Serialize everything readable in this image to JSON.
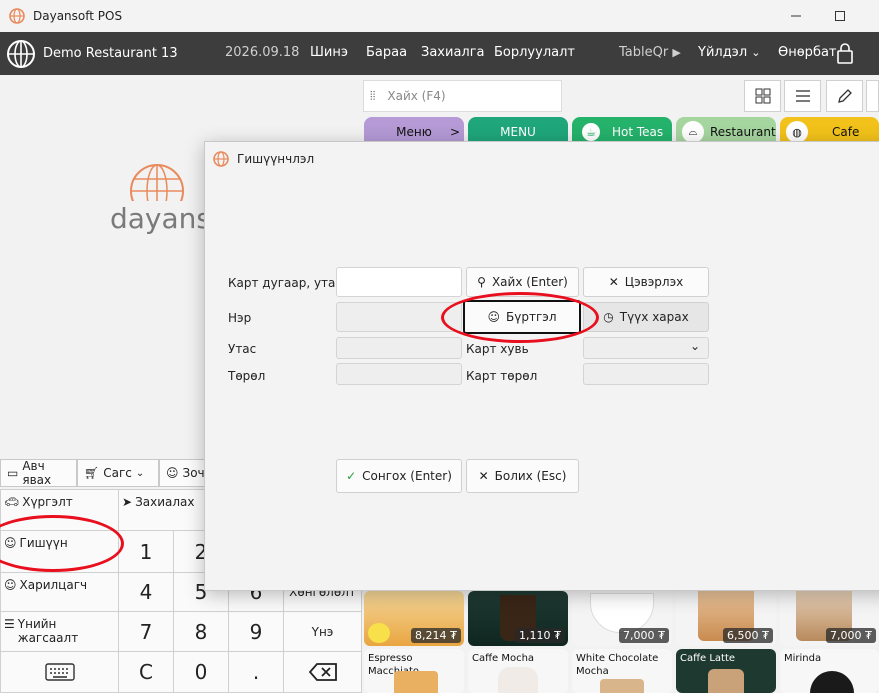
{
  "window": {
    "title": "Dayansoft POS"
  },
  "header": {
    "restaurant": "Demo Restaurant 13",
    "date": "2026.09.18",
    "menu": [
      "Шинэ",
      "Бараа",
      "Захиалга",
      "Борлуулалт"
    ],
    "tableqr": "TableQr",
    "actions": "Үйлдэл",
    "user": "Өнөрбат"
  },
  "left": {
    "logo_text": "dayans",
    "toolbar": [
      "Авч явах",
      "Сагс",
      "Зоч"
    ],
    "side": [
      "Хүргэлт",
      "Захиалах",
      "Гишүүн",
      "Харилцагч",
      "Үнийн жагсаалт"
    ],
    "keys": [
      "1",
      "2",
      "4",
      "5",
      "6",
      "7",
      "8",
      "9",
      "C",
      "0",
      "."
    ],
    "key_labels": {
      "honglolt": "Хөнгөлөлт",
      "une": "Үнэ"
    }
  },
  "right": {
    "search_placeholder": "Хайх (F4)",
    "categories": [
      "Меню",
      "MENU",
      "Hot Teas",
      "Restaurant",
      "Cafe"
    ],
    "products_row1": [
      {
        "price": "8,214 ₮"
      },
      {
        "price": "1,110 ₮"
      },
      {
        "price": "7,000 ₮"
      },
      {
        "price": "6,500 ₮"
      },
      {
        "price": "7,000 ₮"
      }
    ],
    "products_row2": [
      "Espresso Macchiato",
      "Caffe Mocha",
      "White Chocolate Mocha",
      "Caffe Latte",
      "Mirinda"
    ]
  },
  "dialog": {
    "title": "Гишүүнчлэл",
    "card_label": "Карт дугаар, утас",
    "search_btn": "Хайх (Enter)",
    "clear_btn": "Цэвэрлэх",
    "name_label": "Нэр",
    "register_btn": "Бүртгэл",
    "history_btn": "Түүх харах",
    "phone_label": "Утас",
    "card_share_label": "Карт хувь",
    "type_label": "Төрөл",
    "card_type_label": "Карт төрөл",
    "select_btn": "Сонгох (Enter)",
    "cancel_btn": "Болих (Esc)"
  },
  "colors": {
    "header": "#3d3d3d",
    "menu_cat": "#b59ad6",
    "menu2_cat": "#1fa67a",
    "hot_teas": "#25b26b",
    "restaurant": "#a6d6a0",
    "cafe": "#f2c21a",
    "annotation": "#e8101e"
  }
}
